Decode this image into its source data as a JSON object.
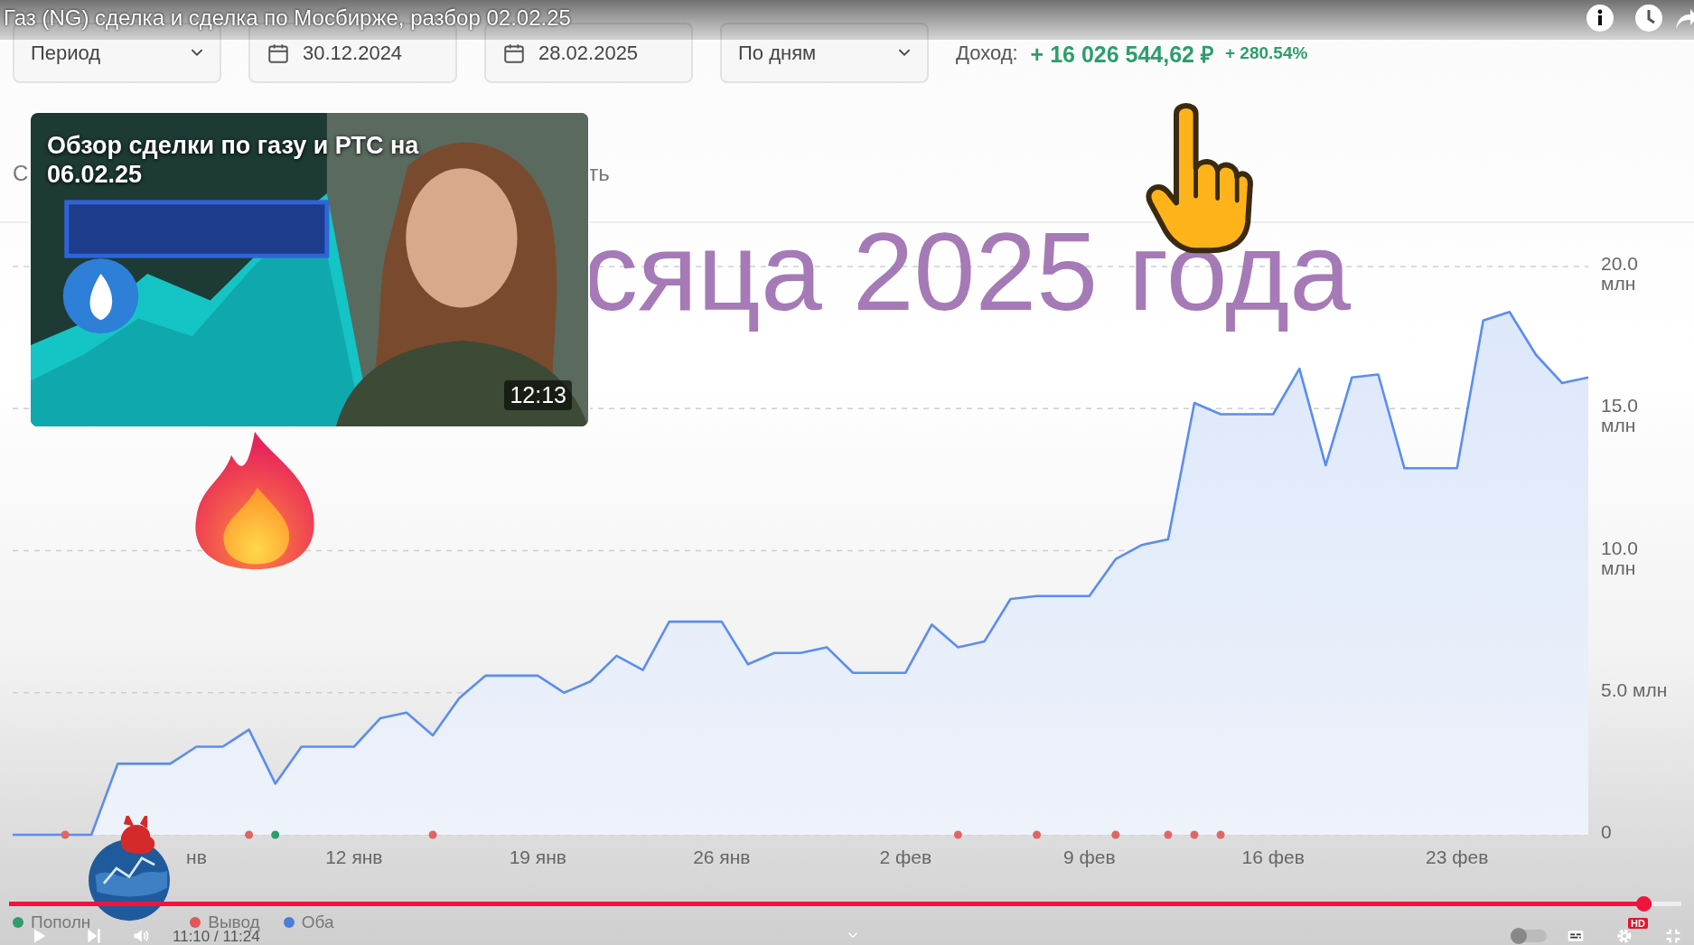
{
  "player": {
    "title": "Газ (NG) сделка и сделка по Мосбирже, разбор 02.02.25",
    "progress": {
      "level": 0.982
    },
    "time": "11:10 / 11:24",
    "autoplay": {
      "on": false
    },
    "quality_badge": "HD"
  },
  "toolbar": {
    "period": "Период",
    "date_from": "30.12.2024",
    "date_to": "28.02.2025",
    "grouping": "По дням",
    "income_label": "Доход:",
    "income_value": "+ 16 026 544,62 ₽",
    "income_percent": "+ 280.54%"
  },
  "tab_fragments": [
    "С",
    "ть"
  ],
  "overlay_caption": "сяца 2025 года",
  "end_card": {
    "title": "Обзор сделки по газу и РТС на 06.02.25",
    "duration": "12:13"
  },
  "chart": {
    "chart_data": {
      "type": "area",
      "grid": true,
      "ylim": [
        0,
        20
      ],
      "categories": [
        null,
        null,
        null,
        null,
        null,
        null,
        null,
        "нв",
        null,
        null,
        null,
        null,
        null,
        "12 янв",
        null,
        null,
        null,
        null,
        null,
        null,
        "19 янв",
        null,
        null,
        null,
        null,
        null,
        null,
        "26 янв",
        null,
        null,
        null,
        null,
        null,
        null,
        "2 фев",
        null,
        null,
        null,
        null,
        null,
        null,
        "9 фев",
        null,
        null,
        null,
        null,
        null,
        null,
        "16 фев",
        null,
        null,
        null,
        null,
        null,
        null,
        "23 фев",
        null,
        null,
        null,
        null,
        null
      ],
      "series": [
        {
          "color": "#5b8def",
          "values": [
            0,
            0,
            0,
            0,
            2.5,
            2.5,
            2.5,
            3.1,
            3.1,
            3.7,
            1.8,
            3.1,
            3.1,
            3.1,
            4.1,
            4.3,
            3.5,
            4.8,
            5.6,
            5.6,
            5.6,
            5.0,
            5.4,
            6.3,
            5.8,
            7.5,
            7.5,
            7.5,
            6.0,
            6.4,
            6.4,
            6.6,
            5.7,
            5.7,
            5.7,
            7.4,
            6.6,
            6.8,
            8.3,
            8.4,
            8.4,
            8.4,
            9.7,
            10.2,
            10.4,
            15.2,
            14.8,
            14.8,
            14.8,
            16.4,
            13.0,
            16.1,
            16.2,
            12.9,
            12.9,
            12.9,
            18.1,
            18.4,
            16.9,
            15.9,
            16.1
          ]
        },
        {
          "type": "scatter",
          "color": "#e06666",
          "values": [
            null,
            null,
            0,
            null,
            null,
            null,
            null,
            null,
            null,
            0,
            null,
            null,
            null,
            null,
            null,
            null,
            0,
            null,
            null,
            null,
            null,
            null,
            null,
            null,
            null,
            null,
            null,
            null,
            null,
            null,
            null,
            null,
            null,
            null,
            null,
            null,
            0,
            null,
            null,
            0,
            null,
            null,
            0,
            null,
            0,
            0,
            0,
            null,
            null,
            null,
            null,
            null,
            null,
            null,
            null,
            null,
            null,
            null,
            null,
            null,
            null
          ]
        },
        {
          "type": "scatter",
          "color": "#2e9d6b",
          "values": [
            null,
            null,
            null,
            null,
            null,
            null,
            null,
            null,
            null,
            null,
            0,
            null,
            null,
            null,
            null,
            null,
            null,
            null,
            null,
            null,
            null,
            null,
            null,
            null,
            null,
            null,
            null,
            null,
            null,
            null,
            null,
            null,
            null,
            null,
            null,
            null,
            null,
            null,
            null,
            null,
            null,
            null,
            null,
            null,
            null,
            null,
            null,
            null,
            null,
            null,
            null,
            null,
            null,
            null,
            null,
            null,
            null,
            null,
            null,
            null,
            null
          ]
        }
      ],
      "yticks": [
        {
          "value": 0,
          "label": "0"
        },
        {
          "value": 5,
          "label": "5.0 млн"
        },
        {
          "value": 10,
          "label": "10.0 млн"
        },
        {
          "value": 15,
          "label": "15.0 млн"
        },
        {
          "value": 20,
          "label": "20.0 млн"
        }
      ]
    }
  },
  "legend": [
    {
      "label": "Пополн",
      "color": "#2e9d6b"
    },
    {
      "label": "Вывод",
      "color": "#e05757"
    },
    {
      "label": "Оба",
      "color": "#4a7fd8"
    }
  ]
}
